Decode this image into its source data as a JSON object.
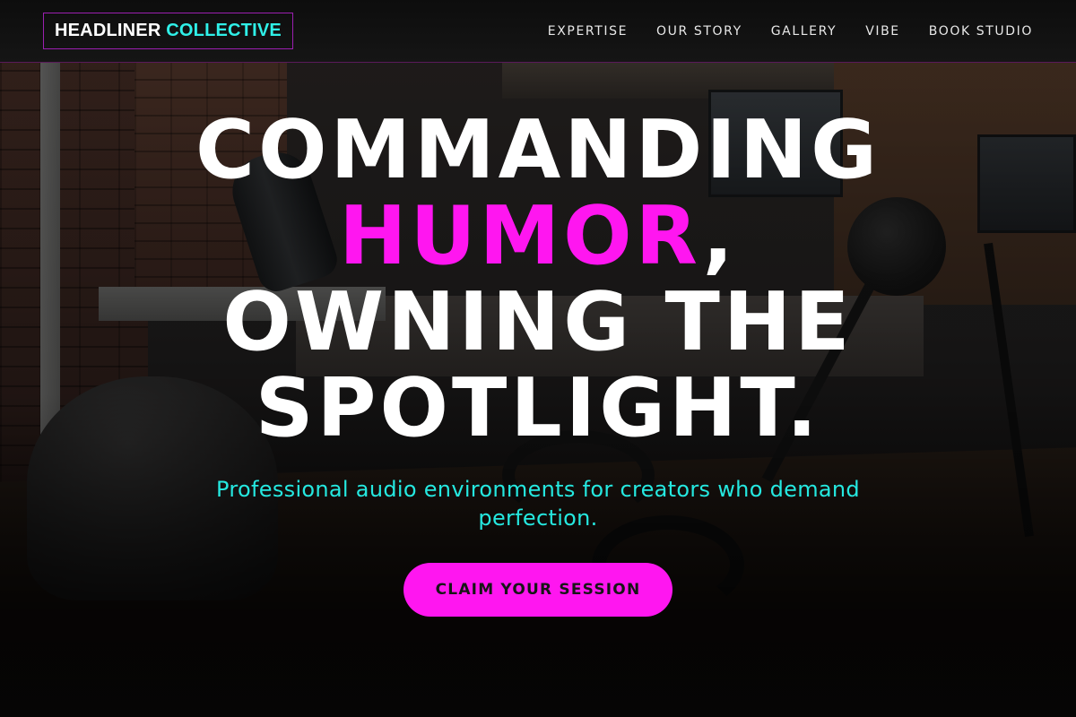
{
  "nav": {
    "logo": {
      "word1": "HEADLINER",
      "word2": "COLLECTIVE"
    },
    "links": [
      "EXPERTISE",
      "OUR STORY",
      "GALLERY",
      "VIBE",
      "BOOK STUDIO"
    ]
  },
  "hero": {
    "headline": {
      "line1": "COMMANDING",
      "accent": "HUMOR",
      "comma": ",",
      "line3": "OWNING THE",
      "line4": "SPOTLIGHT."
    },
    "tagline": "Professional audio environments for creators who demand perfection.",
    "cta_label": "CLAIM YOUR SESSION"
  },
  "colors": {
    "accent_magenta": "#ff16f0",
    "accent_cyan": "#25e8e0",
    "nav_background": "#111111"
  }
}
